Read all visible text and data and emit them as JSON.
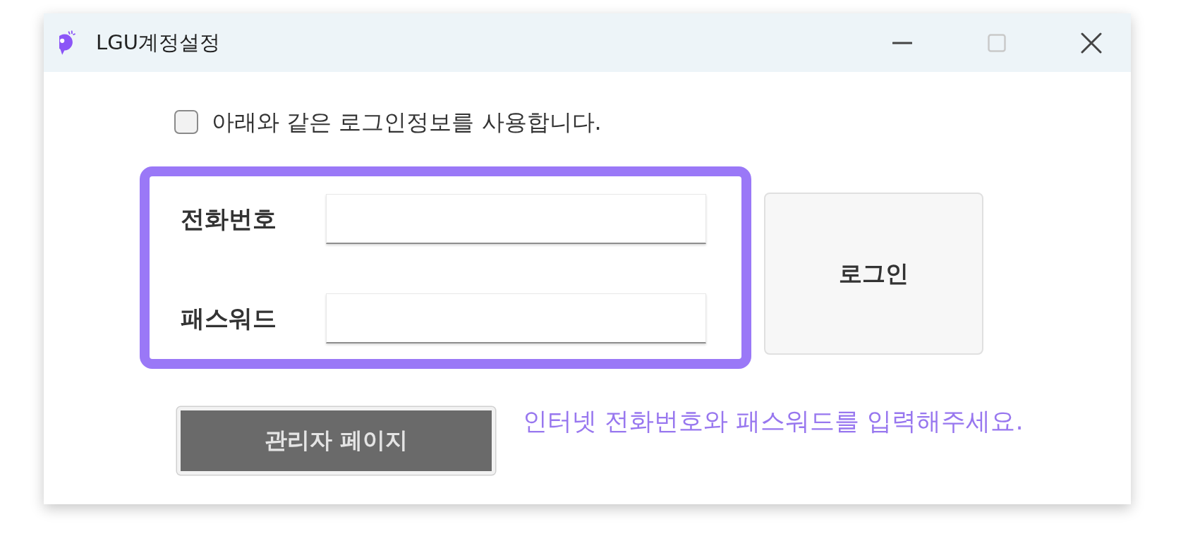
{
  "window": {
    "title": "LGU계정설정",
    "controls": [
      {
        "kind": "minimize",
        "disabled": false
      },
      {
        "kind": "maximize",
        "disabled": true
      },
      {
        "kind": "close",
        "disabled": false
      }
    ]
  },
  "use_login_info": {
    "label": "아래와 같은 로그인정보를 사용합니다.",
    "checked": false
  },
  "fields": [
    {
      "label": "전화번호"
    },
    {
      "label": "패스워드"
    }
  ],
  "login_button": {
    "label": "로그인"
  },
  "admin_button": {
    "label": "관리자 페이지"
  },
  "hint": "인터넷 전화번호와 패스워드를 입력해주세요."
}
